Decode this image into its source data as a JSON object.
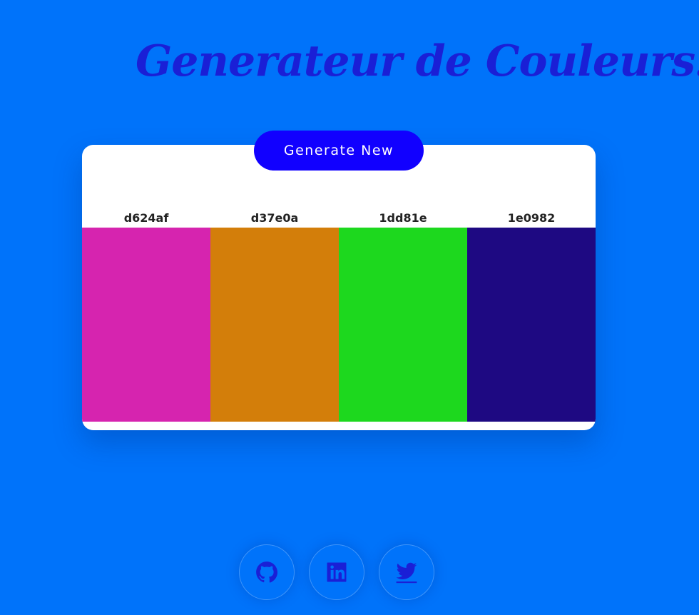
{
  "page": {
    "title": "Generateur de Couleurs:"
  },
  "generate_button": {
    "label": "Generate New"
  },
  "palette": [
    {
      "hex": "d624af",
      "color": "#d624af"
    },
    {
      "hex": "d37e0a",
      "color": "#d37e0a"
    },
    {
      "hex": "1dd81e",
      "color": "#1dd81e"
    },
    {
      "hex": "1e0982",
      "color": "#1e0982"
    }
  ],
  "colors": {
    "background": "#0073fa",
    "title": "#1a1fd6",
    "button": "#1100ff",
    "icons": "#1a1fd6"
  },
  "social": [
    {
      "name": "github",
      "icon": "github-icon"
    },
    {
      "name": "linkedin",
      "icon": "linkedin-icon"
    },
    {
      "name": "twitter",
      "icon": "twitter-icon"
    }
  ]
}
